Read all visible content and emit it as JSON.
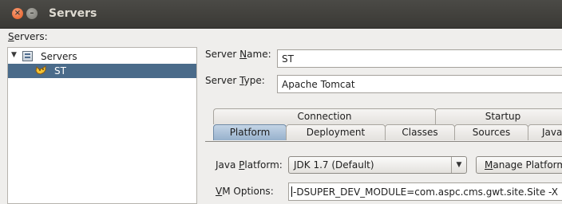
{
  "window": {
    "title": "Servers"
  },
  "servers_label": {
    "mnemonic": "S",
    "rest": "ervers:"
  },
  "tree": {
    "root": {
      "label": "Servers",
      "icon": "server-group-icon"
    },
    "child": {
      "label": "ST",
      "icon": "tomcat-icon",
      "selected": true
    }
  },
  "form": {
    "server_name": {
      "label_pre": "Server ",
      "mnemonic": "N",
      "label_post": "ame:",
      "value": "ST"
    },
    "server_type": {
      "label_pre": "Server ",
      "mnemonic": "T",
      "label_post": "ype:",
      "value": "Apache Tomcat"
    }
  },
  "tabs": {
    "row1": [
      "Connection",
      "Startup"
    ],
    "row2": [
      "Platform",
      "Deployment",
      "Classes",
      "Sources",
      "Java"
    ],
    "active": "Platform"
  },
  "platform": {
    "java_platform": {
      "label_pre": "Java ",
      "mnemonic": "P",
      "label_post": "latform:",
      "value": "JDK 1.7 (Default)"
    },
    "manage_button": {
      "mnemonic": "M",
      "rest": "anage Platform"
    },
    "vm_options": {
      "mnemonic": "V",
      "label_post": "M Options:",
      "value": "-DSUPER_DEV_MODULE=com.aspc.cms.gwt.site.Site  -X"
    }
  },
  "colors": {
    "titlebar": "#3c3b37",
    "selection": "#4a6b8a",
    "active_tab": "#a9c0d8"
  }
}
